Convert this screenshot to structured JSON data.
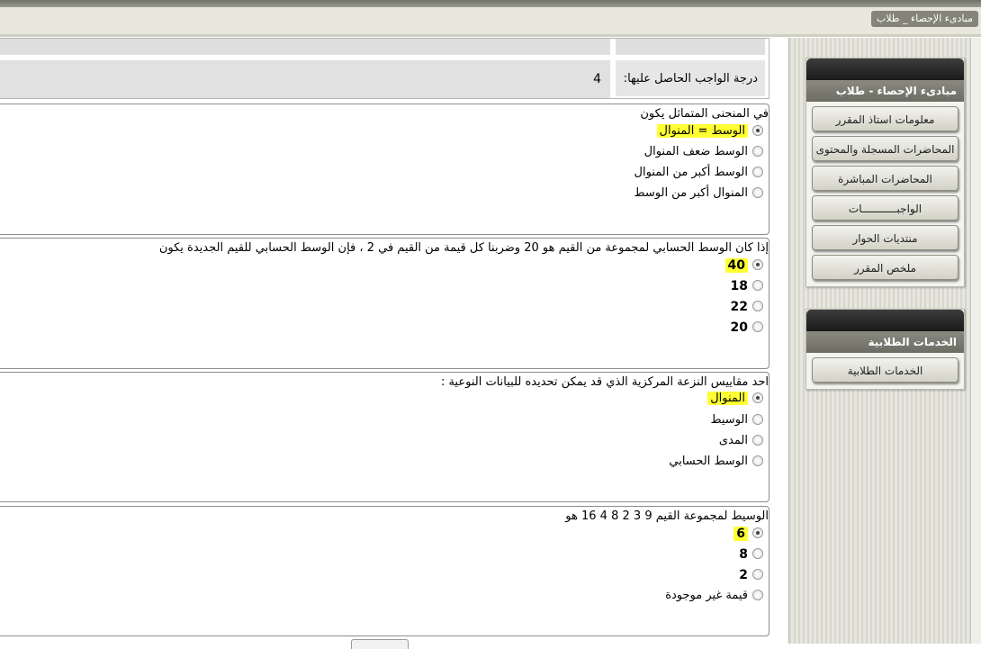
{
  "window": {
    "title": "مبادىء الإحصاء _ طلاب"
  },
  "sidebar": {
    "course_panel": {
      "title": "مبادىء الإحصاء - طلاب",
      "items": [
        {
          "label": "معلومات استاذ المقرر"
        },
        {
          "label": "المحاضرات المسجلة والمحتوى"
        },
        {
          "label": "المحاضرات المباشرة"
        },
        {
          "label": "الواجبـــــــــــات"
        },
        {
          "label": "منتديات الحوار"
        },
        {
          "label": "ملخص المقرر"
        }
      ]
    },
    "services_panel": {
      "title": "الخدمات الطلابية",
      "items": [
        {
          "label": "الخدمات الطلابية"
        }
      ]
    }
  },
  "grade": {
    "label": "درجة الواجب الحاصل عليها:",
    "value": "4"
  },
  "questions": [
    {
      "text": "في المنحنى المتماثل يكون",
      "options": [
        {
          "label": "الوسط = المنوال",
          "selected": true
        },
        {
          "label": "الوسط ضعف المنوال",
          "selected": false
        },
        {
          "label": "الوسط أكبر من المنوال",
          "selected": false
        },
        {
          "label": "المنوال أكبر من الوسط",
          "selected": false
        }
      ]
    },
    {
      "text": "إذا كان الوسط الحسابي لمجموعة من القيم هو 20 وضربنا كل قيمة من القيم في 2 ، فإن الوسط الحسابي للقيم الجديدة يكون",
      "options": [
        {
          "label": "40",
          "selected": true
        },
        {
          "label": "18",
          "selected": false
        },
        {
          "label": "22",
          "selected": false
        },
        {
          "label": "20",
          "selected": false
        }
      ]
    },
    {
      "text": "احد مقاييس النزعة المركزية الذي قد يمكن تحديده للبيانات النوعية :",
      "options": [
        {
          "label": "المنوال",
          "selected": true
        },
        {
          "label": "الوسيط",
          "selected": false
        },
        {
          "label": "المدى",
          "selected": false
        },
        {
          "label": "الوسط الحسابي",
          "selected": false
        }
      ]
    },
    {
      "text": "الوسيط لمجموعة القيم 9 3 2 8 4 16 هو",
      "options": [
        {
          "label": "6",
          "selected": true
        },
        {
          "label": "8",
          "selected": false
        },
        {
          "label": "2",
          "selected": false
        },
        {
          "label": "قيمة غير موجودة",
          "selected": false
        }
      ]
    }
  ],
  "colors": {
    "highlight": "#ffff33",
    "sidebar_header": "#1a1a1a",
    "sidebar_title": "#75756b"
  }
}
